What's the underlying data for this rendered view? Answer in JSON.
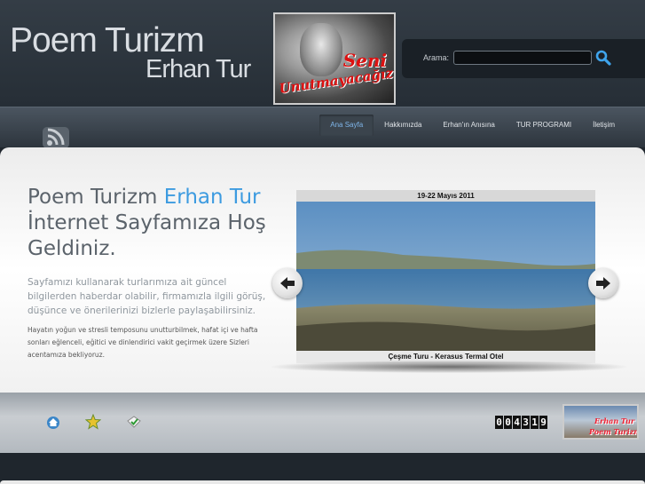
{
  "header": {
    "brand_title": "Poem Turizm",
    "brand_subtitle": "Erhan Tur",
    "photo_text_line1": "Seni",
    "photo_text_line2": "Unutmayacağız"
  },
  "search": {
    "label": "Arama:",
    "value": "",
    "button_icon": "search-icon"
  },
  "nav": {
    "items": [
      {
        "label": "Ana Sayfa",
        "active": true
      },
      {
        "label": "Hakkımızda",
        "active": false
      },
      {
        "label": "Erhan'ın Anısına",
        "active": false
      },
      {
        "label": "TUR PROGRAMI",
        "active": false
      },
      {
        "label": "İletişim",
        "active": false
      }
    ]
  },
  "main": {
    "headline_part1": "Poem Turizm ",
    "headline_highlight": "Erhan Tur",
    "headline_part2": "İnternet Sayfamıza Hoş Geldiniz.",
    "intro": "Sayfamızı kullanarak turlarımıza ait güncel bilgilerden haberdar olabilir, firmamızla ilgili görüş, düşünce ve önerilerinizi bizlerle paylaşabilirsiniz.",
    "intro_small": "Hayatın yoğun ve stresli temposunu unutturbilmek, hafat içi ve hafta sonları eğlenceli, eğitici ve dinlendirici vakit geçirmek üzere Sizleri acentamıza bekliyoruz."
  },
  "slider": {
    "title": "19-22 Mayıs 2011",
    "caption": "Çeşme Turu - Kerasus Termal Otel",
    "prev_icon": "arrow-left-icon",
    "next_icon": "arrow-right-icon"
  },
  "footer": {
    "icons": [
      "home-icon",
      "star-icon",
      "bookmark-icon"
    ],
    "counter_digits": [
      "0",
      "0",
      "4",
      "3",
      "1",
      "9"
    ],
    "badge_line1": "Erhan Tur",
    "badge_line2": "Poem Turizm"
  },
  "colors": {
    "accent": "#3d9be0",
    "header_bg": "#343d46",
    "text_gray": "#5b636b"
  }
}
